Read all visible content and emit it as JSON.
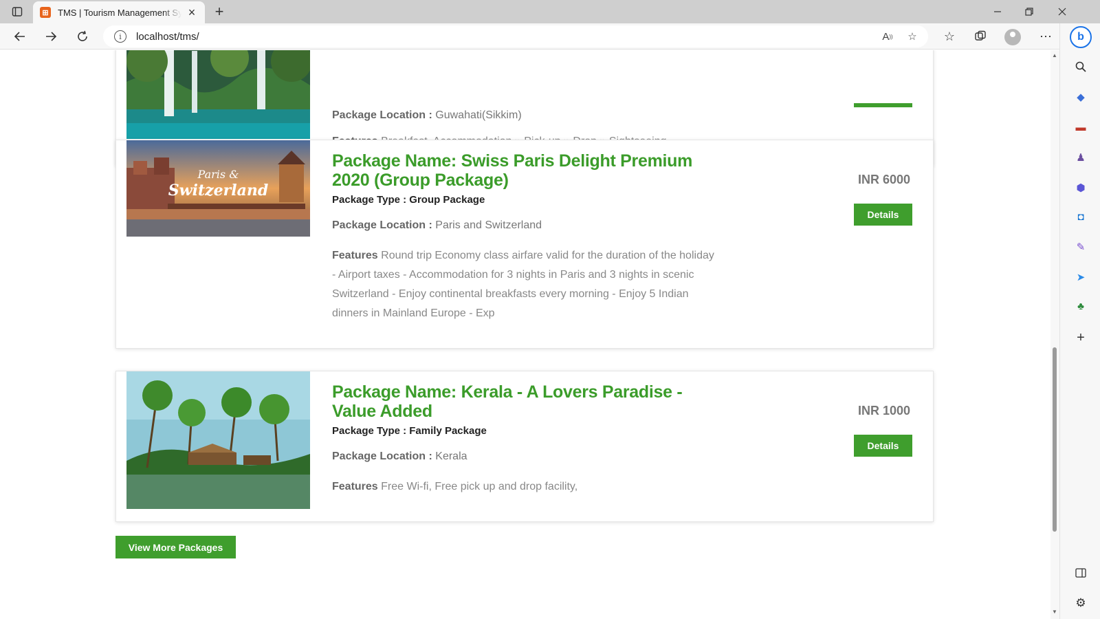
{
  "browser": {
    "tab_title": "TMS | Tourism Management System",
    "tab_favicon_letter": "⊞",
    "url": "localhost/tms/"
  },
  "packages": [
    {
      "location_label": "Package Location :",
      "location": "Guwahati(Sikkim)",
      "features_label": "Features",
      "features": "Breakfast, Accommodation » Pick-up » Drop » Sightseeing",
      "image": "waterfall-image"
    },
    {
      "name": "Package Name: Swiss Paris Delight Premium 2020 (Group Package)",
      "type": "Package Type : Group Package",
      "location_label": "Package Location :",
      "location": "Paris and Switzerland",
      "features_label": "Features",
      "features": "Round trip Economy class airfare valid for the duration of the holiday - Airport taxes - Accommodation for 3 nights in Paris and 3 nights in scenic Switzerland - Enjoy continental breakfasts every morning - Enjoy 5 Indian dinners in Mainland Europe - Exp",
      "price": "INR 6000",
      "details_label": "Details",
      "image_text_1": "Paris &",
      "image_text_2": "Switzerland"
    },
    {
      "name": "Package Name: Kerala - A Lovers Paradise - Value Added",
      "type": "Package Type : Family Package",
      "location_label": "Package Location :",
      "location": "Kerala",
      "features_label": "Features",
      "features": "Free Wi-fi, Free pick up and drop facility,",
      "price": "INR 1000",
      "details_label": "Details"
    }
  ],
  "view_more_label": "View More Packages",
  "colors": {
    "brand_green": "#3f9e2d",
    "title_green": "#3b9c2a"
  }
}
